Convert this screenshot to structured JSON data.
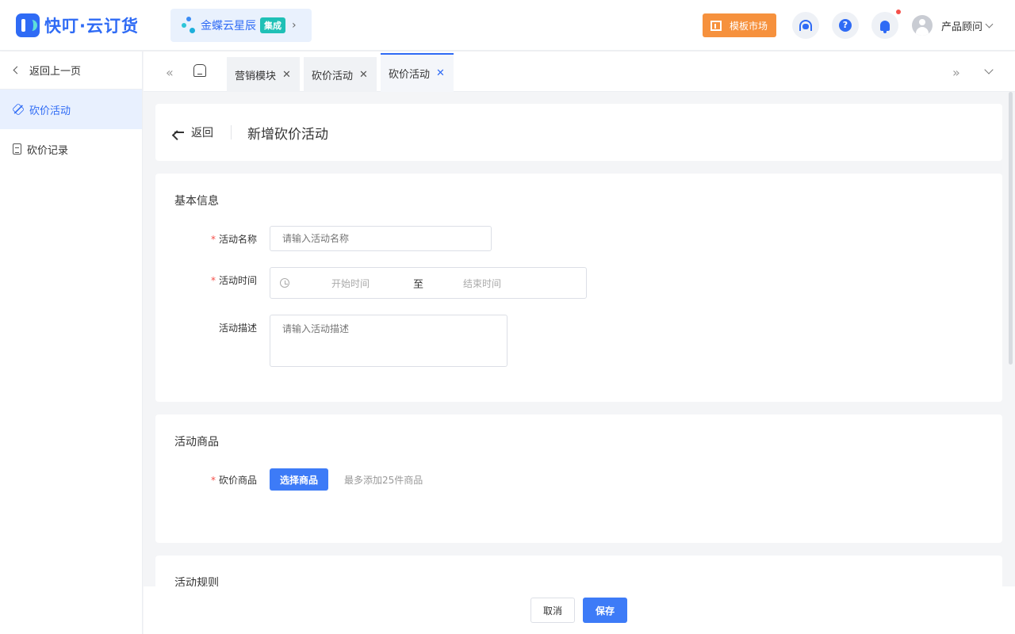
{
  "header": {
    "brand": "快叮·云订货",
    "kingdee_name": "金蝶云星辰",
    "kingdee_badge": "集成",
    "market_label": "模板市场",
    "user_name": "产品顾问",
    "has_unread_notifications": true
  },
  "sidebar": {
    "back_label": "返回上一页",
    "items": [
      {
        "label": "砍价活动",
        "icon": "bargain-tag-icon",
        "active": true
      },
      {
        "label": "砍价记录",
        "icon": "record-doc-icon",
        "active": false
      }
    ]
  },
  "tabs": [
    {
      "label": "营销模块",
      "active": false
    },
    {
      "label": "砍价活动",
      "active": false
    },
    {
      "label": "砍价活动",
      "active": true
    }
  ],
  "page_header": {
    "back_label": "返回",
    "title": "新增砍价活动"
  },
  "basic_info": {
    "section_title": "基本信息",
    "name_label": "活动名称",
    "name_placeholder": "请输入活动名称",
    "time_label": "活动时间",
    "time_start_placeholder": "开始时间",
    "time_separator": "至",
    "time_end_placeholder": "结束时间",
    "desc_label": "活动描述",
    "desc_placeholder": "请输入活动描述"
  },
  "goods": {
    "section_title": "活动商品",
    "goods_label": "砍价商品",
    "select_button": "选择商品",
    "hint": "最多添加25件商品"
  },
  "rules": {
    "section_title": "活动规则"
  },
  "footer": {
    "cancel_label": "取消",
    "save_label": "保存"
  },
  "colors": {
    "primary": "#3d7bf7",
    "accent_orange": "#f6913d",
    "required_star": "#f5504a",
    "badge_teal": "#1fc0b6"
  }
}
